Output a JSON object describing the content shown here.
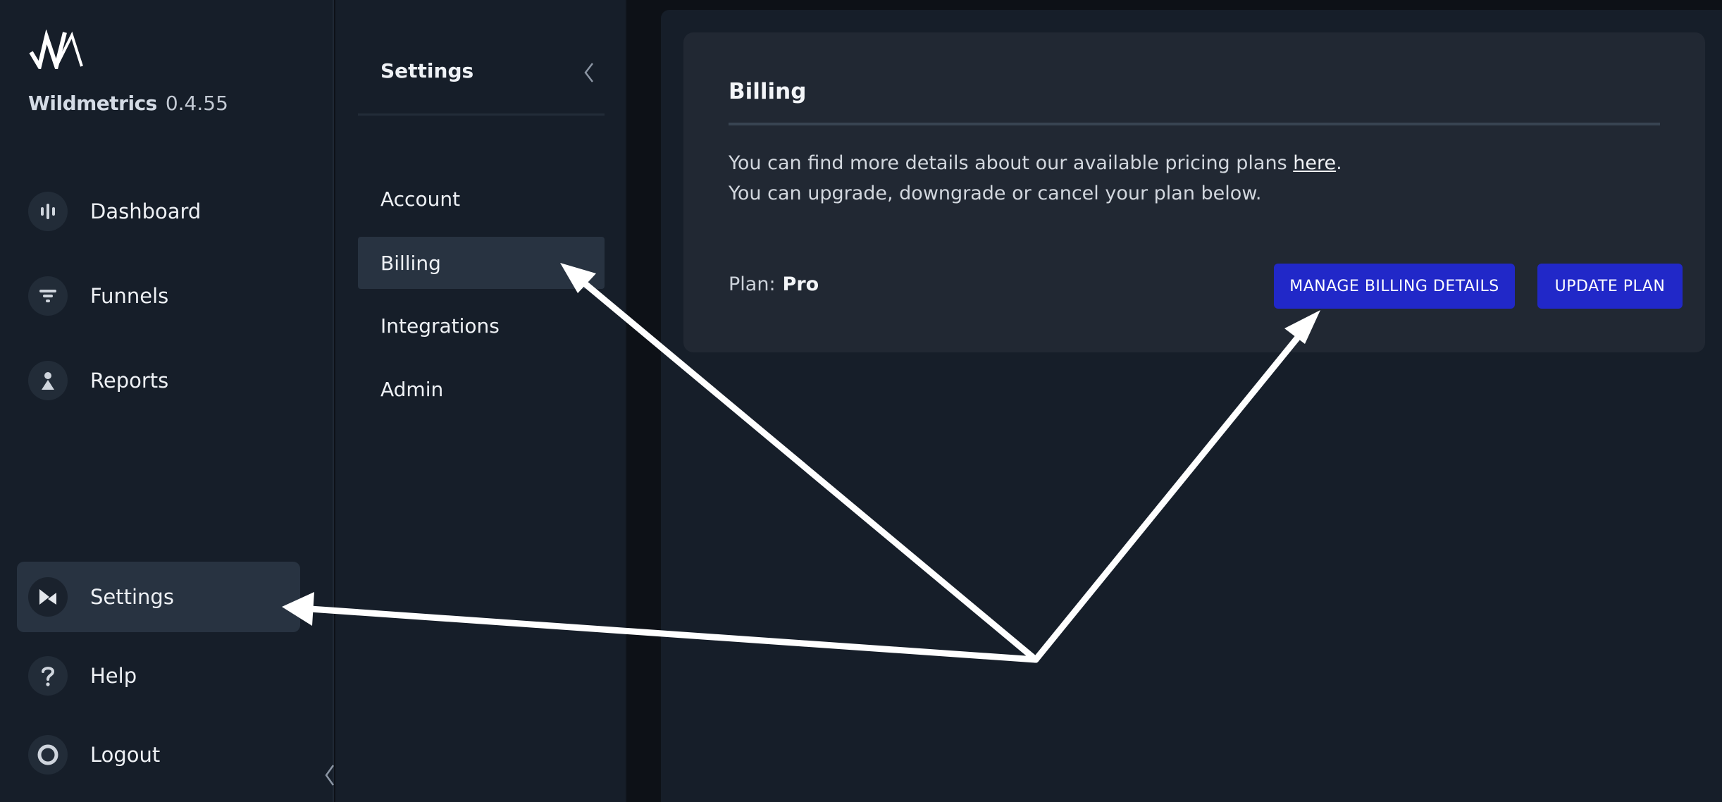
{
  "app": {
    "name": "Wildmetrics",
    "version": "0.4.55"
  },
  "sidebar": {
    "items": [
      {
        "label": "Dashboard",
        "icon": "bar-chart-icon"
      },
      {
        "label": "Funnels",
        "icon": "funnel-icon"
      },
      {
        "label": "Reports",
        "icon": "person-icon"
      }
    ],
    "bottom_items": [
      {
        "label": "Settings",
        "icon": "settings-flag-icon",
        "active": true
      },
      {
        "label": "Help",
        "icon": "question-icon"
      },
      {
        "label": "Logout",
        "icon": "circle-icon"
      }
    ]
  },
  "settings_nav": {
    "title": "Settings",
    "items": [
      {
        "label": "Account"
      },
      {
        "label": "Billing",
        "active": true
      },
      {
        "label": "Integrations"
      },
      {
        "label": "Admin"
      }
    ]
  },
  "billing": {
    "title": "Billing",
    "line1_before": "You can find more details about our available pricing plans ",
    "line1_link": "here",
    "line1_after": ".",
    "line2": "You can upgrade, downgrade or cancel your plan below.",
    "plan_label": "Plan:",
    "plan_value": "Pro",
    "manage_button": "MANAGE BILLING DETAILS",
    "update_button": "UPDATE PLAN"
  },
  "colors": {
    "background": "#0d1117",
    "panel": "#161e29",
    "card": "#212833",
    "active_item": "#283341",
    "primary_button": "#2128c8"
  }
}
